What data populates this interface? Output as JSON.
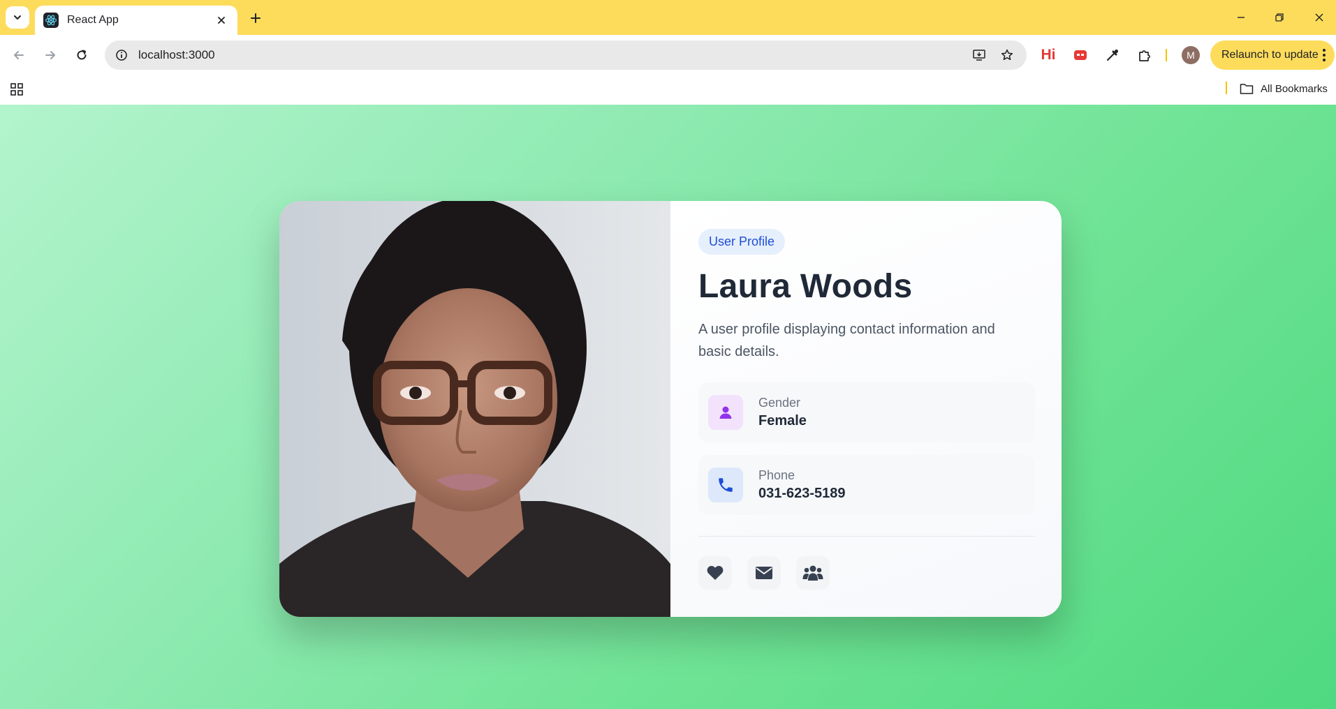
{
  "browser": {
    "tab_title": "React App",
    "url": "localhost:3000",
    "extension_hi_label": "Hi",
    "avatar_initial": "M",
    "relaunch_label": "Relaunch to update",
    "bookmarks_all_label": "All Bookmarks",
    "accent_color": "#fddc5c"
  },
  "profile": {
    "badge": "User Profile",
    "name": "Laura Woods",
    "description": "A user profile displaying contact information and basic details.",
    "fields": [
      {
        "label": "Gender",
        "value": "Female",
        "icon": "person-icon",
        "color": "#9333ea"
      },
      {
        "label": "Phone",
        "value": "031-623-5189",
        "icon": "phone-icon",
        "color": "#1d4ed8"
      }
    ],
    "actions": [
      {
        "icon": "heart-icon"
      },
      {
        "icon": "envelope-icon"
      },
      {
        "icon": "users-icon"
      }
    ],
    "photo_alt": "profile photo"
  }
}
